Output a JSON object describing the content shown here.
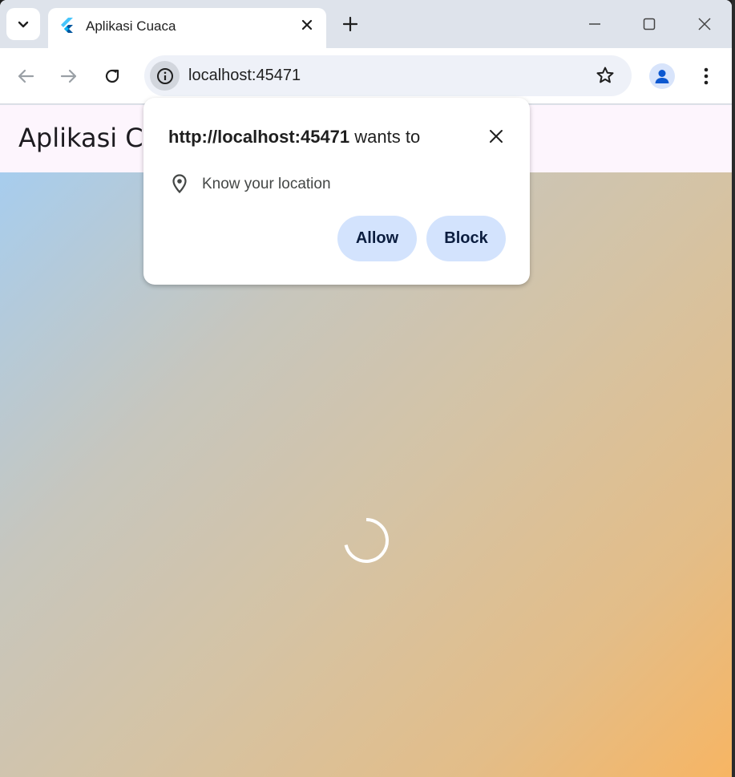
{
  "browser": {
    "tab_title": "Aplikasi Cuaca",
    "url": "localhost:45471"
  },
  "app": {
    "title": "Aplikasi Cuaca",
    "gradient_colors": [
      "#a7cdee",
      "#c7c6bd",
      "#d5c3a4",
      "#e3bd88",
      "#f7b563"
    ]
  },
  "popup": {
    "origin": "http://localhost:45471",
    "wants_to": "wants to",
    "permission_text": "Know your location",
    "allow_label": "Allow",
    "block_label": "Block"
  },
  "icons": {
    "tab_search": "chevron-down-icon",
    "favicon": "flutter-icon",
    "tab_close": "close-icon",
    "new_tab": "plus-icon",
    "minimize": "minimize-icon",
    "maximize": "maximize-icon",
    "close_window": "close-icon",
    "back": "arrow-left-icon",
    "forward": "arrow-right-icon",
    "reload": "reload-icon",
    "site_info": "info-icon",
    "bookmark": "star-icon",
    "profile": "person-icon",
    "menu": "kebab-menu-icon",
    "location": "location-pin-icon"
  }
}
